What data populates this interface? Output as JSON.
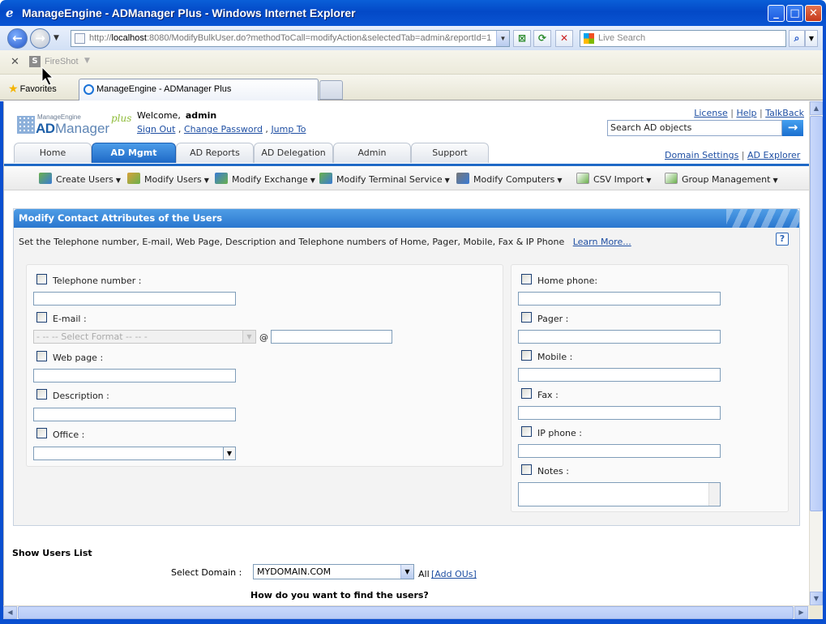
{
  "window": {
    "title": "ManageEngine - ADManager Plus - Windows Internet Explorer",
    "minimize": "_",
    "maximize": "□",
    "close": "✕"
  },
  "browser": {
    "url_prefix": "http://",
    "url_host": "localhost",
    "url_rest": ":8080/ModifyBulkUser.do?methodToCall=modifyAction&selectedTab=admin&reportId=1",
    "search_placeholder": "Live Search",
    "fireshot_label": "FireShot",
    "favorites_label": "Favorites",
    "tab_title": "ManageEngine - ADManager Plus"
  },
  "app": {
    "logo_me": "ManageEngine",
    "logo_ad": "AD",
    "logo_manager": "Manager",
    "logo_plus": "plus",
    "welcome_label": "Welcome,",
    "username": "admin",
    "sign_out": "Sign Out",
    "change_password": "Change Password",
    "jump_to": "Jump To",
    "license": "License",
    "help": "Help",
    "talkback": "TalkBack",
    "search_placeholder": "Search AD objects",
    "domain_settings": "Domain Settings",
    "ad_explorer": "AD Explorer",
    "tabs": [
      "Home",
      "AD Mgmt",
      "AD Reports",
      "AD Delegation",
      "Admin",
      "Support"
    ],
    "active_tab": "AD Mgmt",
    "subnav": [
      {
        "label": "Create Users",
        "icon": "users-add-icon"
      },
      {
        "label": "Modify Users",
        "icon": "user-edit-icon"
      },
      {
        "label": "Modify Exchange",
        "icon": "exchange-icon"
      },
      {
        "label": "Modify Terminal Service",
        "icon": "terminal-service-icon"
      },
      {
        "label": "Modify Computers",
        "icon": "computer-icon"
      },
      {
        "label": "CSV Import",
        "icon": "csv-import-icon"
      },
      {
        "label": "Group Management",
        "icon": "group-icon"
      }
    ]
  },
  "panel": {
    "title": "Modify Contact Attributes of the Users",
    "description": "Set the Telephone number, E-mail, Web Page, Description and Telephone numbers of Home, Pager, Mobile, Fax & IP Phone",
    "learn_more": "Learn More...",
    "help_icon": "?",
    "left_fields": {
      "telephone": "Telephone number :",
      "email": "E-mail :",
      "email_format_placeholder": "- -- -- Select Format -- -- -",
      "at_sign": "@",
      "webpage": "Web page :",
      "description": "Description :",
      "office": "Office :"
    },
    "right_fields": {
      "home_phone": "Home phone:",
      "pager": "Pager :",
      "mobile": "Mobile :",
      "fax": "Fax :",
      "ip_phone": "IP phone :",
      "notes": "Notes :"
    }
  },
  "users": {
    "heading": "Show Users List",
    "select_domain_label": "Select Domain :",
    "domain_value": "MYDOMAIN.COM",
    "all_label": "All",
    "add_ous": "[Add OUs]",
    "how_find": "How do you want to find the users?"
  }
}
